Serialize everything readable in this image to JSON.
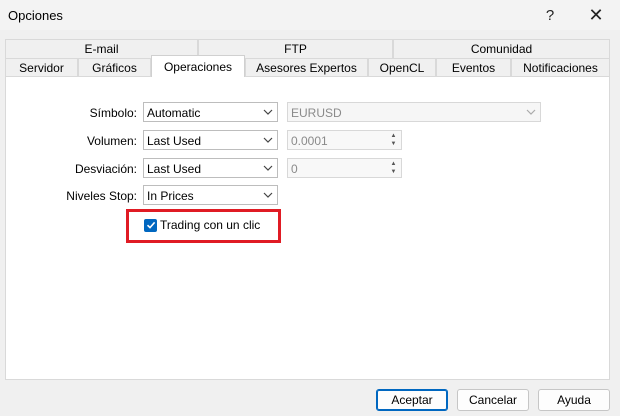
{
  "window": {
    "title": "Opciones",
    "help": "?",
    "close": "✕"
  },
  "tabs_row1": [
    "E-mail",
    "FTP",
    "Comunidad"
  ],
  "tabs_row2": [
    "Servidor",
    "Gráficos",
    "Operaciones",
    "Asesores Expertos",
    "OpenCL",
    "Eventos",
    "Notificaciones"
  ],
  "active_tab": "Operaciones",
  "form": {
    "simbolo": {
      "label": "Símbolo:",
      "value": "Automatic",
      "symbol": "EURUSD"
    },
    "volumen": {
      "label": "Volumen:",
      "value": "Last Used",
      "amount": "0.0001"
    },
    "desviacion": {
      "label": "Desviación:",
      "value": "Last Used",
      "amount": "0"
    },
    "niveles": {
      "label": "Niveles Stop:",
      "value": "In Prices"
    },
    "one_click": {
      "label": "Trading con un clic",
      "checked": true
    }
  },
  "buttons": {
    "ok": "Aceptar",
    "cancel": "Cancelar",
    "help": "Ayuda"
  },
  "colors": {
    "accent": "#0067c0",
    "highlight": "#e01b24"
  }
}
